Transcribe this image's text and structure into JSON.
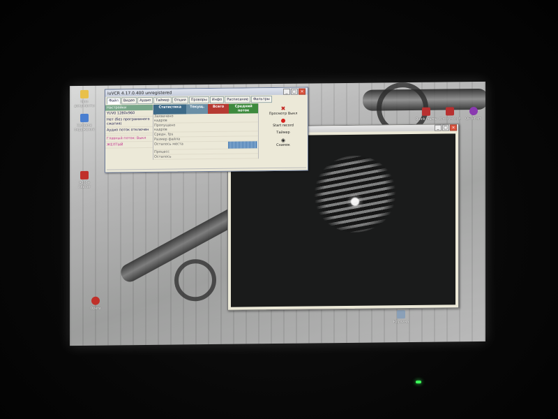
{
  "colors": {
    "accent_green": "#79a78a",
    "record_red": "#d8231e",
    "power_led": "#3cff5a"
  },
  "vcr_window": {
    "title": "iuVCR 4.17.0.400 unregistered",
    "tabs": [
      "Файл",
      "Видео",
      "Аудио",
      "Таймер",
      "Опции",
      "Проворы",
      "Инфо",
      "Расписание",
      "Фильтры"
    ],
    "left_panel": {
      "header": "Настройки",
      "rows": [
        "YUV0 1280x960",
        "Нет (без программного сжатия)",
        "Аудио поток отключен",
        "",
        "Главный поток: Выкл",
        "ЖЕЛТЫЙ"
      ]
    },
    "stats": {
      "headers": [
        "Статистика",
        "Текущ.",
        "Всего",
        "Средний поток"
      ],
      "rows": [
        {
          "label": "Захвачено кадров",
          "cur": "",
          "total": "",
          "avg": ""
        },
        {
          "label": "Пропущено кадров",
          "cur": "",
          "total": "",
          "avg": ""
        },
        {
          "label": "Средн. fps",
          "cur": "",
          "total": "",
          "avg": ""
        },
        {
          "label": "Размер файла",
          "cur": "",
          "total": "",
          "avg": ""
        },
        {
          "label": "Осталось места",
          "cur": "",
          "total": "",
          "avg": ""
        },
        {
          "label": "Процесс",
          "cur": "",
          "total": "",
          "avg": ""
        },
        {
          "label": "Осталось",
          "cur": "",
          "total": "",
          "avg": ""
        }
      ]
    },
    "right_panel": {
      "preview_label": "Просмотр Выкл",
      "record_label": "Start record",
      "timer_label": "Таймер",
      "snapshot_label": "Снимок"
    },
    "status_text": ""
  },
  "desktop_icons": [
    {
      "label": "Мои документы",
      "icon": "folder-icon",
      "color": "#e8c04a"
    },
    {
      "label": "Сетевое окружение",
      "icon": "network-icon",
      "color": "#4a7fd0"
    },
    {
      "label": "Adobe Reader",
      "icon": "pdf-icon",
      "color": "#c0302a"
    },
    {
      "label": "Opera",
      "icon": "opera-icon",
      "color": "#c0302a"
    },
    {
      "label": "Корзина",
      "icon": "recycle-bin-icon",
      "color": "#8aa0b8"
    },
    {
      "label": "Quick Frame",
      "icon": "app-icon",
      "color": "#b83030"
    },
    {
      "label": "AtmosFringe",
      "icon": "app-icon",
      "color": "#b83030"
    },
    {
      "label": "QFTPrism",
      "icon": "app-icon",
      "color": "#8a3ab0"
    }
  ]
}
